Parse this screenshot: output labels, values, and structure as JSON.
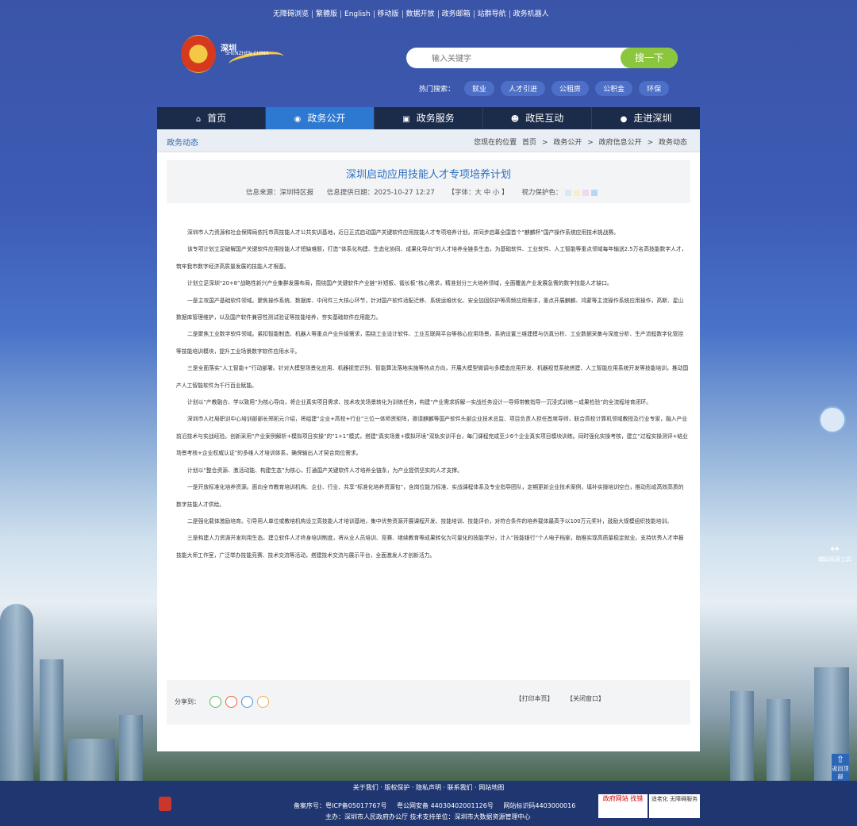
{
  "topbar": [
    "无障碍浏览",
    "繁體版",
    "English",
    "移动版",
    "数据开放",
    "政务邮箱",
    "站群导航",
    "政务机器人"
  ],
  "logo": {
    "title": "深圳",
    "sub": "SHENZHEN CHINA"
  },
  "search": {
    "placeholder": "输入关键字",
    "button": "搜一下"
  },
  "hot": {
    "label": "热门搜索：",
    "tags": [
      "就业",
      "人才引进",
      "公租房",
      "公积金",
      "环保"
    ]
  },
  "nav": [
    "首页",
    "政务公开",
    "政务服务",
    "政民互动",
    "走进深圳"
  ],
  "crumb": {
    "section": "政务动态",
    "path": [
      "您现在的位置",
      "首页",
      ">",
      "政务公开",
      ">",
      "政府信息公开",
      ">",
      "政务动态"
    ]
  },
  "article": {
    "title": "深圳启动应用技能人才专项培养计划",
    "source": "信息来源：深圳特区报",
    "date": "信息提供日期：2025-10-27 12:27",
    "font": "【字体：大 中 小 】",
    "eye": "视力保护色：",
    "eye_colors": [
      "#d9e8f6",
      "#f6f0c8",
      "#f4d6ef",
      "#b9d6f3"
    ],
    "paragraphs": [
      "深圳市人力资源和社会保障局依托市高技能人才公共实训基地，近日正式启动国产关键软件应用技能人才专项培养计划，并同步启幕全国首个“麒麟杯”国产操作系统应用技术挑战赛。",
      "该专项计划立足破解国产关键软件应用技能人才短缺难题，打造“体系化构建、生态化协同、成果化导向”的人才培养全链条生态，为基础软件、工业软件、人工智能等重点领域每年输送2.5万名高技能数字人才，筑牢我市数字经济高质量发展的技能人才根基。",
      "计划立足深圳“20+8”战略性新兴产业集群发展布局，围绕国产关键软件产业链“补短板、锻长板”核心需求，精准划分三大培养领域，全面覆盖产业发展急需的数字技能人才缺口。",
      "一是主攻国产基础软件领域。聚焦操作系统、数据库、中间件三大核心环节，针对国产软件适配迁移、系统运维优化、安全加固防护等高频应用需求，重点开展麒麟、鸿蒙等主流操作系统应用操作，高斯、星山数据库管理维护，以及国产软件兼容性测试验证等技能培养，夯实基础软件应用能力。",
      "二是聚焦工业数字软件领域。紧扣智能制造、机器人等重点产业升级需求，围绕工业设计软件、工业互联网平台等核心应用场景，系统设置三维建模与仿真分析、工业数据采集与深度分析、生产流程数字化管控等技能培训模块，提升工业场景数字软件应用水平。",
      "三是全面落实“人工智能+”行动部署。针对大模型场景化应用、机器视觉识别、智能算法落地实施等热点方向，开展大模型微调与多模态应用开发、机器视觉系统搭建、人工智能应用系统开发等技能培训，推动国产人工智能软件为千行百业赋能。",
      "计划以“产教融合、学以致用”为核心导向，将企业真实项目需求、技术攻关场景转化为训练任务，构建“产业需求拆解—实战任务设计—导师带教指导—沉浸式训练—成果检验”的全流程培育闭环。",
      "深圳市人社局职训中心培训部部长郑凯元介绍，将组建“企业+高校+行业”三位一体师资矩阵，邀请麒麟等国产软件头部企业技术总监、项目负责人担任首席导师，联合高校计算机领域教授及行业专家，融入产业前沿技术与实战经验。创新采用“产业案例解析+模拟项目实操”的“1+1”模式，搭建“真实场景+模拟环境”双轨实训平台，每门课程完成至少6个企业真实项目模块训练。同时强化实操考核，建立“过程实操测评+结业场景考核+企业权威认证”的多维人才培训体系，确保输出人才契合岗位需求。",
      "计划以“整合资源、激活动能、构建生态”为核心，打通国产关键软件人才培养全链条，为产业提供坚实的人才支撑。",
      "一是开放标准化培养资源。面向全市教育培训机构、企业、行业、共享“标准化培养资源包”，含岗位能力标准、实战课程体系及专业指导团队，定期更新企业技术案例，填补实操培训空白，推动形成高效高质的数字技能人才供给。",
      "二是强化载体激励培育。引导用人单位或教培机构设立高技能人才培训基地，集中优势资源开展课程开发、技能培训、技能评价，对符合条件的培养载体最高予以100万元奖补，鼓励大规模组织技能培训。",
      "三是构建人力资源开发利用生态。建立软件人才终身培训制度，将从业人员培训、竞赛、继续教育等成果转化为可量化的技能学分，计入“技能银行”个人电子档案，助推实现高质量稳定就业。支持优秀人才申报技能大师工作室，广泛举办技能竞赛、技术交流等活动，搭建技术交流与展示平台，全面激发人才创新活力。"
    ]
  },
  "share": {
    "label": "分享到：",
    "print": "【打印本页】",
    "close": "【关闭窗口】"
  },
  "side": {
    "tools": "辅助阅读工具",
    "top": "返回顶部"
  },
  "footer": {
    "links": "关于我们 · 版权保护 · 隐私声明 · 联系我们 · 网站地图",
    "icp": "备案序号：粤ICP备05017767号",
    "police": "粤公网安备 44030402001126号",
    "code": "网站标识码4403000016",
    "host": "主办：深圳市人民政府办公厅   技术支持单位：深圳市大数据资源管理中心",
    "badge1": "政府网站 找错",
    "badge2": "适老化 无障碍服务"
  }
}
